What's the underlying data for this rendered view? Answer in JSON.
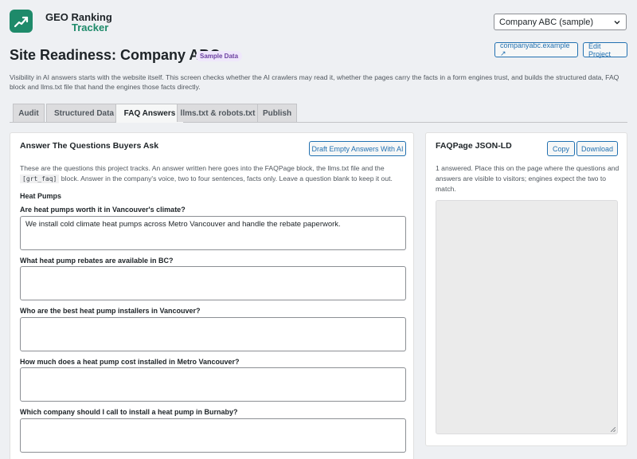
{
  "app": {
    "title_line1": "GEO Ranking",
    "title_line2": "Tracker",
    "colors": {
      "brand": "#1e8a6a",
      "accent": "#2271b1",
      "badge": "#6b3fa0"
    }
  },
  "project_select": {
    "value": "Company ABC (sample)",
    "icon": "chevron-down-icon"
  },
  "page": {
    "title": "Site Readiness: Company ABC",
    "badge": "Sample Data",
    "site_link": "companyabc.example ↗",
    "edit_button": "Edit Project",
    "intro": "Visibility in AI answers starts with the website itself. This screen checks whether the AI crawlers may read it, whether the pages carry the facts in a form engines trust, and builds the structured data, FAQ block and llms.txt file that hand the engines those facts directly."
  },
  "tabs": [
    {
      "label": "Audit"
    },
    {
      "label": "Structured Data"
    },
    {
      "label": "FAQ Answers"
    },
    {
      "label": "llms.txt & robots.txt"
    },
    {
      "label": "Publish"
    }
  ],
  "faq_panel": {
    "title": "Answer The Questions Buyers Ask",
    "draft_button": "Draft Empty Answers With AI",
    "desc_part1": "These are the questions this project tracks. An answer written here goes into the FAQPage block, the llms.txt file and the",
    "desc_code": "[grt_faq]",
    "desc_part2": "block. Answer in the company's voice, two to four sentences, facts only. Leave a question blank to keep it out.",
    "group": "Heat Pumps",
    "questions": [
      {
        "label": "Are heat pumps worth it in Vancouver's climate?",
        "answer": "We install cold climate heat pumps across Metro Vancouver and handle the rebate paperwork."
      },
      {
        "label": "What heat pump rebates are available in BC?",
        "answer": ""
      },
      {
        "label": "Who are the best heat pump installers in Vancouver?",
        "answer": ""
      },
      {
        "label": "How much does a heat pump cost installed in Metro Vancouver?",
        "answer": ""
      },
      {
        "label": "Which company should I call to install a heat pump in Burnaby?",
        "answer": ""
      }
    ]
  },
  "json_panel": {
    "title": "FAQPage JSON-LD",
    "copy_button": "Copy",
    "download_button": "Download",
    "desc": "1 answered. Place this on the page where the questions and answers are visible to visitors; engines expect the two to match.",
    "output": ""
  }
}
